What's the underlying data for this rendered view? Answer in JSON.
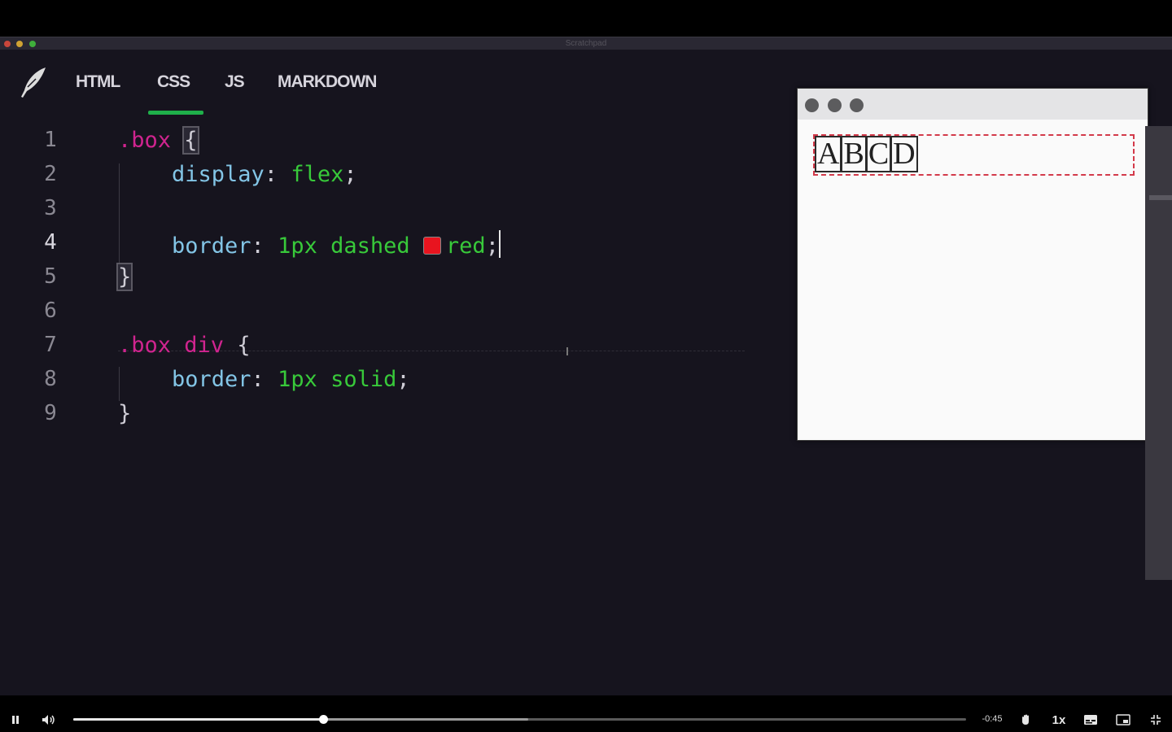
{
  "window": {
    "title": "Scratchpad"
  },
  "tabs": [
    {
      "label": "HTML"
    },
    {
      "label": "CSS"
    },
    {
      "label": "JS"
    },
    {
      "label": "MARKDOWN"
    }
  ],
  "active_tab": "CSS",
  "editor": {
    "lines": [
      {
        "n": "1",
        "selector": ".box",
        "brace": "{"
      },
      {
        "n": "2",
        "prop": "display",
        "value": "flex"
      },
      {
        "n": "3"
      },
      {
        "n": "4",
        "prop": "border",
        "v1": "1px",
        "v2": "dashed",
        "v3": "red"
      },
      {
        "n": "5",
        "brace": "}"
      },
      {
        "n": "6"
      },
      {
        "n": "7",
        "selector": ".box",
        "tag": "div",
        "brace": "{"
      },
      {
        "n": "8",
        "prop": "border",
        "v1": "1px",
        "v2": "solid"
      },
      {
        "n": "9",
        "brace": "}"
      }
    ],
    "swatch_color": "#e8141f"
  },
  "preview": {
    "items": [
      "A",
      "B",
      "C",
      "D"
    ],
    "box_border_color": "#d33a4a"
  },
  "player": {
    "time_remaining": "-0:45",
    "speed": "1x",
    "progress": 0.28,
    "buffered": 0.51
  },
  "icons": {
    "logo": "quill-icon",
    "pause": "pause-icon",
    "volume": "volume-icon",
    "hand": "hand-icon",
    "captions": "captions-icon",
    "pip": "picture-in-picture-icon",
    "exit_fullscreen": "exit-fullscreen-icon"
  },
  "colors": {
    "accent": "#1fb04a",
    "selector": "#d0248f",
    "property": "#83c5e6",
    "value": "#38c93a"
  }
}
